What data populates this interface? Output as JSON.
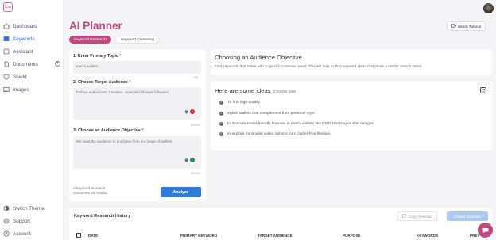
{
  "app": {
    "logo_text": "Lio"
  },
  "sidebar": {
    "items": [
      {
        "label": "Dashboard"
      },
      {
        "label": "Keywords"
      },
      {
        "label": "Assistant"
      },
      {
        "label": "Documents"
      },
      {
        "label": "Shield"
      },
      {
        "label": "Images"
      }
    ],
    "bottom_items": [
      {
        "label": "Switch Theme"
      },
      {
        "label": "Support"
      },
      {
        "label": "Account"
      }
    ]
  },
  "header": {
    "title": "AI Planner",
    "tabs": [
      {
        "label": "Keyword Research"
      },
      {
        "label": "Keyword Clustering"
      }
    ],
    "tutorial_label": "Watch Tutorial"
  },
  "form": {
    "topic_label": "1. Enter Primary Topic",
    "topic_value": "men's wallets",
    "topic_count": "/60",
    "audience_label": "2. Choose Target Audience",
    "audience_value": "fashion enthusiasts, travelers, minimalist lifestyle followers",
    "audience_badge": "1",
    "audience_count": "62/200",
    "objective_label": "3. Choose an Audience Objective",
    "objective_value": "We want the audience to purchase from our range of wallets",
    "objective_count": "58/250",
    "required_mark": "*",
    "credits_text": "A keyword research consumes 20 credits.",
    "analyze_label": "Analyze"
  },
  "objective": {
    "title": "Choosing an Audience Objective",
    "text": "Find keywords that relate with a specific customer need. This will help us find keyword ideas that share a similar search intent."
  },
  "ideas": {
    "title": "Here are some ideas",
    "subtitle": "(choose one)",
    "items": [
      {
        "text": "To find high-quality"
      },
      {
        "text": "stylish wallets that complement their personal style"
      },
      {
        "text": "to discover travel-friendly features in men's wallets like RFID blocking or slim designs"
      },
      {
        "text": "to explore minimalist wallet options for a clutter-free lifestyle."
      }
    ]
  },
  "history": {
    "title": "Keyword Research History",
    "copy_label": "Copy Selected",
    "cluster_label": "Cluster Selected",
    "columns": [
      "DATE",
      "PRIMARY KEYWORD",
      "TARGET AUDIENCE",
      "PURPOSE",
      "KEYWORDS",
      "PREV"
    ]
  },
  "colors": {
    "brand": "#c2487f",
    "primary_button": "#2f7bd8",
    "active_nav": "#3b6fd8"
  }
}
